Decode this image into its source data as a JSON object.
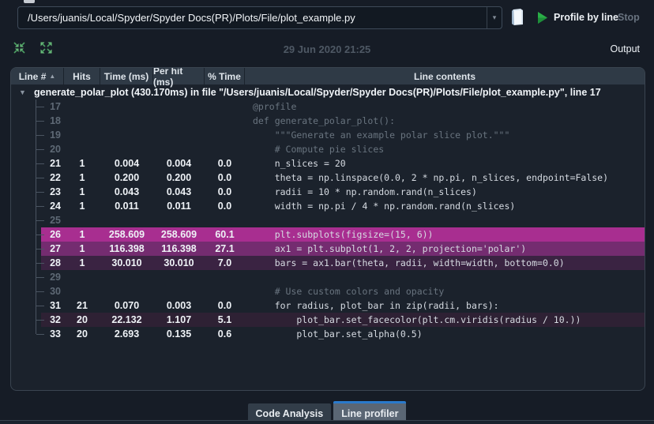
{
  "toolbar": {
    "path_value": "/Users/juanis/Local/Spyder/Spyder Docs(PR)/Plots/File/plot_example.py",
    "profile_label": "Profile by line",
    "stop_label": "Stop"
  },
  "subtoolbar": {
    "timestamp": "29 Jun 2020 21:25",
    "output_label": "Output"
  },
  "icons": {
    "chevron_down": "▾",
    "sort_ascending": "▲",
    "collapse_row": "▼"
  },
  "table": {
    "columns": [
      "Line #",
      "Hits",
      "Time (ms)",
      "Per hit (ms)",
      "% Time",
      "Line contents"
    ],
    "function_row": "generate_polar_plot (430.170ms) in file \"/Users/juanis/Local/Spyder/Spyder Docs(PR)/Plots/File/plot_example.py\", line 17",
    "rows": [
      {
        "line": "17",
        "hits": "",
        "time": "",
        "per_hit": "",
        "pct": "",
        "code": "@profile",
        "executed": false,
        "heat": 0,
        "last": false
      },
      {
        "line": "18",
        "hits": "",
        "time": "",
        "per_hit": "",
        "pct": "",
        "code": "def generate_polar_plot():",
        "executed": false,
        "heat": 0,
        "last": false
      },
      {
        "line": "19",
        "hits": "",
        "time": "",
        "per_hit": "",
        "pct": "",
        "code": "    \"\"\"Generate an example polar slice plot.\"\"\"",
        "executed": false,
        "heat": 0,
        "last": false
      },
      {
        "line": "20",
        "hits": "",
        "time": "",
        "per_hit": "",
        "pct": "",
        "code": "    # Compute pie slices",
        "executed": false,
        "heat": 0,
        "last": false
      },
      {
        "line": "21",
        "hits": "1",
        "time": "0.004",
        "per_hit": "0.004",
        "pct": "0.0",
        "code": "    n_slices = 20",
        "executed": true,
        "heat": 0,
        "last": false
      },
      {
        "line": "22",
        "hits": "1",
        "time": "0.200",
        "per_hit": "0.200",
        "pct": "0.0",
        "code": "    theta = np.linspace(0.0, 2 * np.pi, n_slices, endpoint=False)",
        "executed": true,
        "heat": 0,
        "last": false
      },
      {
        "line": "23",
        "hits": "1",
        "time": "0.043",
        "per_hit": "0.043",
        "pct": "0.0",
        "code": "    radii = 10 * np.random.rand(n_slices)",
        "executed": true,
        "heat": 0,
        "last": false
      },
      {
        "line": "24",
        "hits": "1",
        "time": "0.011",
        "per_hit": "0.011",
        "pct": "0.0",
        "code": "    width = np.pi / 4 * np.random.rand(n_slices)",
        "executed": true,
        "heat": 0,
        "last": false
      },
      {
        "line": "25",
        "hits": "",
        "time": "",
        "per_hit": "",
        "pct": "",
        "code": "",
        "executed": false,
        "heat": 0,
        "last": false
      },
      {
        "line": "26",
        "hits": "1",
        "time": "258.609",
        "per_hit": "258.609",
        "pct": "60.1",
        "code": "    plt.subplots(figsize=(15, 6))",
        "executed": true,
        "heat": 1,
        "last": false
      },
      {
        "line": "27",
        "hits": "1",
        "time": "116.398",
        "per_hit": "116.398",
        "pct": "27.1",
        "code": "    ax1 = plt.subplot(1, 2, 2, projection='polar')",
        "executed": true,
        "heat": 2,
        "last": false
      },
      {
        "line": "28",
        "hits": "1",
        "time": "30.010",
        "per_hit": "30.010",
        "pct": "7.0",
        "code": "    bars = ax1.bar(theta, radii, width=width, bottom=0.0)",
        "executed": true,
        "heat": 3,
        "last": false
      },
      {
        "line": "29",
        "hits": "",
        "time": "",
        "per_hit": "",
        "pct": "",
        "code": "",
        "executed": false,
        "heat": 0,
        "last": false
      },
      {
        "line": "30",
        "hits": "",
        "time": "",
        "per_hit": "",
        "pct": "",
        "code": "    # Use custom colors and opacity",
        "executed": false,
        "heat": 0,
        "last": false
      },
      {
        "line": "31",
        "hits": "21",
        "time": "0.070",
        "per_hit": "0.003",
        "pct": "0.0",
        "code": "    for radius, plot_bar in zip(radii, bars):",
        "executed": true,
        "heat": 0,
        "last": false
      },
      {
        "line": "32",
        "hits": "20",
        "time": "22.132",
        "per_hit": "1.107",
        "pct": "5.1",
        "code": "        plot_bar.set_facecolor(plt.cm.viridis(radius / 10.))",
        "executed": true,
        "heat": 4,
        "last": false
      },
      {
        "line": "33",
        "hits": "20",
        "time": "2.693",
        "per_hit": "0.135",
        "pct": "0.6",
        "code": "        plot_bar.set_alpha(0.5)",
        "executed": true,
        "heat": 0,
        "last": true
      }
    ]
  },
  "tabs": [
    {
      "label": "Code Analysis",
      "active": false
    },
    {
      "label": "Line profiler",
      "active": true
    }
  ],
  "colors": {
    "heat1": "#A82E90",
    "heat2": "#742C70",
    "heat3": "#3A2342",
    "heat4": "#2E2134",
    "accent_green": "#6FC27F",
    "play_green": "#2AAE47",
    "tab_active_blue": "#2A7ACC",
    "header_bg": "#2F3A46",
    "panel_bg": "#1B222C"
  }
}
